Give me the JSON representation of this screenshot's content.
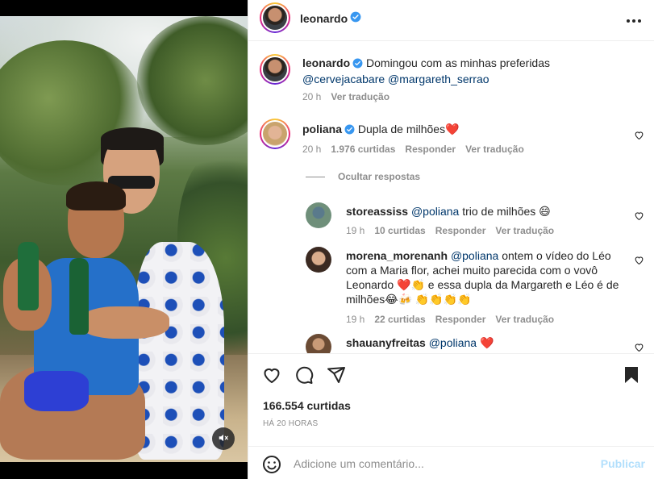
{
  "post": {
    "username": "leonardo",
    "caption_text": "Domingou com as minhas preferidas",
    "caption_mentions": [
      "@cervejacabare",
      "@margareth_serrao"
    ],
    "caption_time": "20 h",
    "caption_translate": "Ver tradução"
  },
  "comments": [
    {
      "username": "poliana",
      "verified": true,
      "text": "Dupla de milhões",
      "emoji": "❤️",
      "time": "20 h",
      "likes": "1.976 curtidas",
      "reply": "Responder",
      "translate": "Ver tradução"
    }
  ],
  "hide_replies": "Ocultar respostas",
  "replies": [
    {
      "username": "storeassiss",
      "mention": "@poliana",
      "text": "trio de milhões 😄",
      "time": "19 h",
      "likes": "10 curtidas",
      "reply": "Responder",
      "translate": "Ver tradução"
    },
    {
      "username": "morena_morenanh",
      "mention": "@poliana",
      "text_line1": "ontem o vídeo do Léo",
      "text_line2": "com a Maria flor, achei muito parecida com o vovô",
      "text_line3": "Leonardo ❤️👏 e essa dupla da Margareth e Léo é de",
      "text_line4": "milhões😂🍻 👏👏👏👏",
      "time": "19 h",
      "likes": "22 curtidas",
      "reply": "Responder",
      "translate": "Ver tradução"
    },
    {
      "username": "shauanyfreitas",
      "mention": "@poliana",
      "text": "❤️"
    }
  ],
  "footer": {
    "likes": "166.554 curtidas",
    "time": "HÁ 20 HORAS",
    "comment_placeholder": "Adicione um comentário...",
    "publish_label": "Publicar"
  },
  "icons": {
    "header_more": "more-horizontal-icon",
    "mute": "speaker-muted-icon",
    "like": "heart-icon",
    "comment": "comment-bubble-icon",
    "share": "paper-plane-icon",
    "save": "bookmark-icon",
    "emoji": "smiley-icon"
  },
  "colors": {
    "verified": "#3897f0",
    "heart_red": "#ed4956",
    "mention": "#00376b",
    "meta_gray": "#8e8e8e",
    "publish_disabled": "#b2dffc"
  }
}
